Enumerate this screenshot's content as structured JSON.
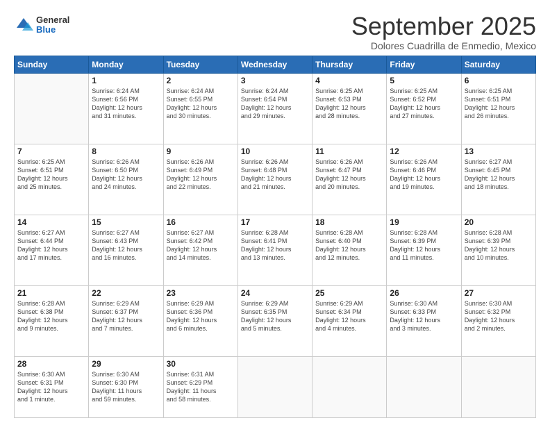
{
  "header": {
    "logo": {
      "general": "General",
      "blue": "Blue"
    },
    "title": "September 2025",
    "subtitle": "Dolores Cuadrilla de Enmedio, Mexico"
  },
  "weekdays": [
    "Sunday",
    "Monday",
    "Tuesday",
    "Wednesday",
    "Thursday",
    "Friday",
    "Saturday"
  ],
  "weeks": [
    [
      {
        "day": "",
        "lines": []
      },
      {
        "day": "1",
        "lines": [
          "Sunrise: 6:24 AM",
          "Sunset: 6:56 PM",
          "Daylight: 12 hours",
          "and 31 minutes."
        ]
      },
      {
        "day": "2",
        "lines": [
          "Sunrise: 6:24 AM",
          "Sunset: 6:55 PM",
          "Daylight: 12 hours",
          "and 30 minutes."
        ]
      },
      {
        "day": "3",
        "lines": [
          "Sunrise: 6:24 AM",
          "Sunset: 6:54 PM",
          "Daylight: 12 hours",
          "and 29 minutes."
        ]
      },
      {
        "day": "4",
        "lines": [
          "Sunrise: 6:25 AM",
          "Sunset: 6:53 PM",
          "Daylight: 12 hours",
          "and 28 minutes."
        ]
      },
      {
        "day": "5",
        "lines": [
          "Sunrise: 6:25 AM",
          "Sunset: 6:52 PM",
          "Daylight: 12 hours",
          "and 27 minutes."
        ]
      },
      {
        "day": "6",
        "lines": [
          "Sunrise: 6:25 AM",
          "Sunset: 6:51 PM",
          "Daylight: 12 hours",
          "and 26 minutes."
        ]
      }
    ],
    [
      {
        "day": "7",
        "lines": [
          "Sunrise: 6:25 AM",
          "Sunset: 6:51 PM",
          "Daylight: 12 hours",
          "and 25 minutes."
        ]
      },
      {
        "day": "8",
        "lines": [
          "Sunrise: 6:26 AM",
          "Sunset: 6:50 PM",
          "Daylight: 12 hours",
          "and 24 minutes."
        ]
      },
      {
        "day": "9",
        "lines": [
          "Sunrise: 6:26 AM",
          "Sunset: 6:49 PM",
          "Daylight: 12 hours",
          "and 22 minutes."
        ]
      },
      {
        "day": "10",
        "lines": [
          "Sunrise: 6:26 AM",
          "Sunset: 6:48 PM",
          "Daylight: 12 hours",
          "and 21 minutes."
        ]
      },
      {
        "day": "11",
        "lines": [
          "Sunrise: 6:26 AM",
          "Sunset: 6:47 PM",
          "Daylight: 12 hours",
          "and 20 minutes."
        ]
      },
      {
        "day": "12",
        "lines": [
          "Sunrise: 6:26 AM",
          "Sunset: 6:46 PM",
          "Daylight: 12 hours",
          "and 19 minutes."
        ]
      },
      {
        "day": "13",
        "lines": [
          "Sunrise: 6:27 AM",
          "Sunset: 6:45 PM",
          "Daylight: 12 hours",
          "and 18 minutes."
        ]
      }
    ],
    [
      {
        "day": "14",
        "lines": [
          "Sunrise: 6:27 AM",
          "Sunset: 6:44 PM",
          "Daylight: 12 hours",
          "and 17 minutes."
        ]
      },
      {
        "day": "15",
        "lines": [
          "Sunrise: 6:27 AM",
          "Sunset: 6:43 PM",
          "Daylight: 12 hours",
          "and 16 minutes."
        ]
      },
      {
        "day": "16",
        "lines": [
          "Sunrise: 6:27 AM",
          "Sunset: 6:42 PM",
          "Daylight: 12 hours",
          "and 14 minutes."
        ]
      },
      {
        "day": "17",
        "lines": [
          "Sunrise: 6:28 AM",
          "Sunset: 6:41 PM",
          "Daylight: 12 hours",
          "and 13 minutes."
        ]
      },
      {
        "day": "18",
        "lines": [
          "Sunrise: 6:28 AM",
          "Sunset: 6:40 PM",
          "Daylight: 12 hours",
          "and 12 minutes."
        ]
      },
      {
        "day": "19",
        "lines": [
          "Sunrise: 6:28 AM",
          "Sunset: 6:39 PM",
          "Daylight: 12 hours",
          "and 11 minutes."
        ]
      },
      {
        "day": "20",
        "lines": [
          "Sunrise: 6:28 AM",
          "Sunset: 6:39 PM",
          "Daylight: 12 hours",
          "and 10 minutes."
        ]
      }
    ],
    [
      {
        "day": "21",
        "lines": [
          "Sunrise: 6:28 AM",
          "Sunset: 6:38 PM",
          "Daylight: 12 hours",
          "and 9 minutes."
        ]
      },
      {
        "day": "22",
        "lines": [
          "Sunrise: 6:29 AM",
          "Sunset: 6:37 PM",
          "Daylight: 12 hours",
          "and 7 minutes."
        ]
      },
      {
        "day": "23",
        "lines": [
          "Sunrise: 6:29 AM",
          "Sunset: 6:36 PM",
          "Daylight: 12 hours",
          "and 6 minutes."
        ]
      },
      {
        "day": "24",
        "lines": [
          "Sunrise: 6:29 AM",
          "Sunset: 6:35 PM",
          "Daylight: 12 hours",
          "and 5 minutes."
        ]
      },
      {
        "day": "25",
        "lines": [
          "Sunrise: 6:29 AM",
          "Sunset: 6:34 PM",
          "Daylight: 12 hours",
          "and 4 minutes."
        ]
      },
      {
        "day": "26",
        "lines": [
          "Sunrise: 6:30 AM",
          "Sunset: 6:33 PM",
          "Daylight: 12 hours",
          "and 3 minutes."
        ]
      },
      {
        "day": "27",
        "lines": [
          "Sunrise: 6:30 AM",
          "Sunset: 6:32 PM",
          "Daylight: 12 hours",
          "and 2 minutes."
        ]
      }
    ],
    [
      {
        "day": "28",
        "lines": [
          "Sunrise: 6:30 AM",
          "Sunset: 6:31 PM",
          "Daylight: 12 hours",
          "and 1 minute."
        ]
      },
      {
        "day": "29",
        "lines": [
          "Sunrise: 6:30 AM",
          "Sunset: 6:30 PM",
          "Daylight: 11 hours",
          "and 59 minutes."
        ]
      },
      {
        "day": "30",
        "lines": [
          "Sunrise: 6:31 AM",
          "Sunset: 6:29 PM",
          "Daylight: 11 hours",
          "and 58 minutes."
        ]
      },
      {
        "day": "",
        "lines": []
      },
      {
        "day": "",
        "lines": []
      },
      {
        "day": "",
        "lines": []
      },
      {
        "day": "",
        "lines": []
      }
    ]
  ]
}
